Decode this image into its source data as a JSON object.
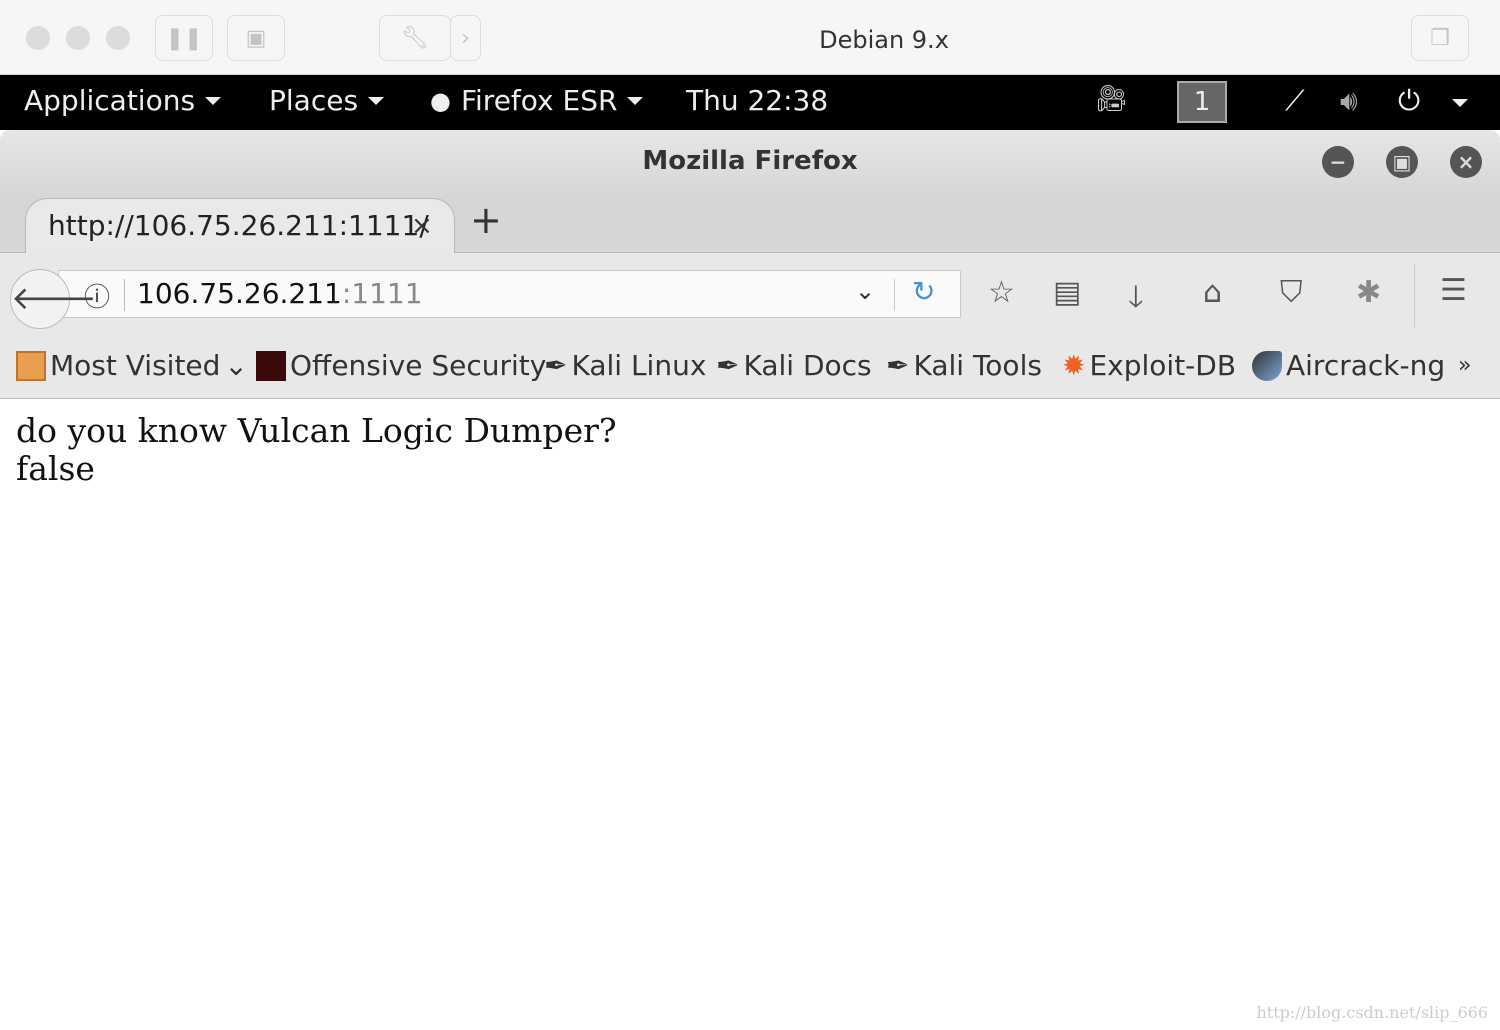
{
  "vm": {
    "title": "Debian 9.x"
  },
  "gnome": {
    "applications": "Applications",
    "places": "Places",
    "app": "Firefox ESR",
    "clock": "Thu 22:38",
    "workspace": "1"
  },
  "firefox": {
    "title": "Mozilla Firefox",
    "tab_title": "http://106.75.26.211:1111/",
    "tab_close": "×",
    "new_tab": "+",
    "url_host": "106.75.26.211",
    "url_port": ":1111"
  },
  "bookmarks": [
    {
      "label": "Most Visited",
      "icon": "folder-icon"
    },
    {
      "label": "Offensive Security",
      "icon": "offsec-icon"
    },
    {
      "label": "Kali Linux",
      "icon": "kali-icon"
    },
    {
      "label": "Kali Docs",
      "icon": "kali-icon"
    },
    {
      "label": "Kali Tools",
      "icon": "kali-icon"
    },
    {
      "label": "Exploit-DB",
      "icon": "exploitdb-icon"
    },
    {
      "label": "Aircrack-ng",
      "icon": "aircrack-icon"
    }
  ],
  "bookmarks_overflow": "»",
  "page": {
    "line1": "do you know Vulcan Logic Dumper?",
    "line2": "false"
  },
  "watermark": "http://blog.csdn.net/slip_666"
}
